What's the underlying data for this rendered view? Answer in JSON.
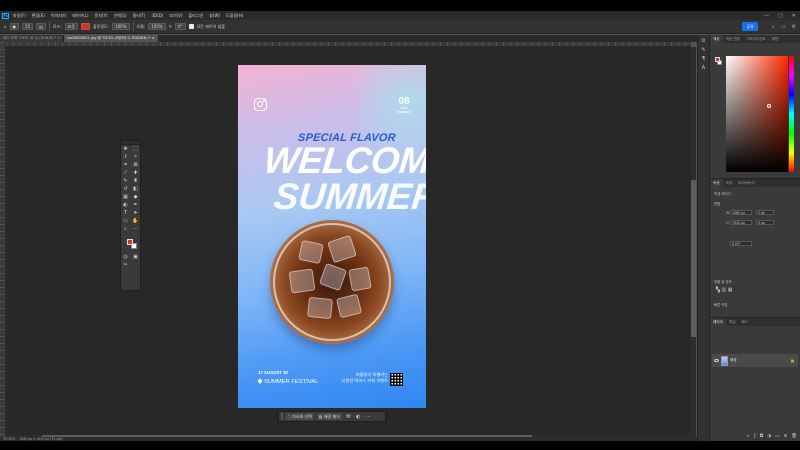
{
  "menu": {
    "app_logo": "Ps",
    "items": [
      "파일(F)",
      "편집(E)",
      "이미지(I)",
      "레이어(L)",
      "문자(Y)",
      "선택(S)",
      "필터(T)",
      "3D(D)",
      "보기(V)",
      "플러그인",
      "창(W)",
      "도움말(H)"
    ]
  },
  "window_controls": {
    "minimize": "—",
    "maximize": "▢",
    "close": "✕"
  },
  "options_bar": {
    "size_value": "15",
    "mode_label": "모드:",
    "mode_value": "표준",
    "opacity_label": "불투명도:",
    "flow_label": "흐름:",
    "flow_value": "100%",
    "zoom_text": "0°",
    "align_label": "모든 레이어 샘플",
    "share_label": "공유"
  },
  "document_tabs": [
    {
      "label": "에어 포맷 스토리 (8.9) (RGB/8) * ×",
      "active": false
    },
    {
      "label": "bz00000001.jpg @ 33.3% (레이어 0, RGB/8#) * ×",
      "active": true
    }
  ],
  "poster": {
    "special": "SPECIAL FLAVOR",
    "welcome": "WELCOME",
    "summer": "SUMMER",
    "date_number": "08",
    "date_sub": "2023 SUMMER",
    "foot_date": "17 AUGUST 30",
    "foot_festival": "SUMMER FESTIVAL",
    "foot_kr_line1": "여름맞이 특별가는",
    "foot_kr_line2": "시원한 아이스 커피 이벤트"
  },
  "context_bar": {
    "subject_label": "피사체 선택",
    "remove_bg_label": "배경 제거",
    "more": "···"
  },
  "status": {
    "zoom": "33.33%",
    "doc_info": "1080 px x 1920 px (72 ppi)"
  },
  "right_panel": {
    "tabs": [
      "색상",
      "색상 견본",
      "그레이디언트",
      "패턴"
    ],
    "properties_tabs": [
      "속성",
      "조정",
      "라이브러리"
    ],
    "properties": {
      "section_pixel": "픽셀 레이어",
      "transform_label": "변형",
      "w_label": "W",
      "w_value": "1080 px",
      "h_label": "H",
      "h_value": "1920 px",
      "x_value": "0 px",
      "y_value": "0 px",
      "angle_value": "0.00°",
      "align_label": "정렬 및 분포",
      "quick_actions": "빠른 작업"
    },
    "layers_tabs": [
      "레이어",
      "채널",
      "패스"
    ],
    "layer_name": "배경"
  },
  "colors": {
    "accent_red": "#c73a2a",
    "share_blue": "#1473e6",
    "poster_blue": "#2b5bc9"
  }
}
